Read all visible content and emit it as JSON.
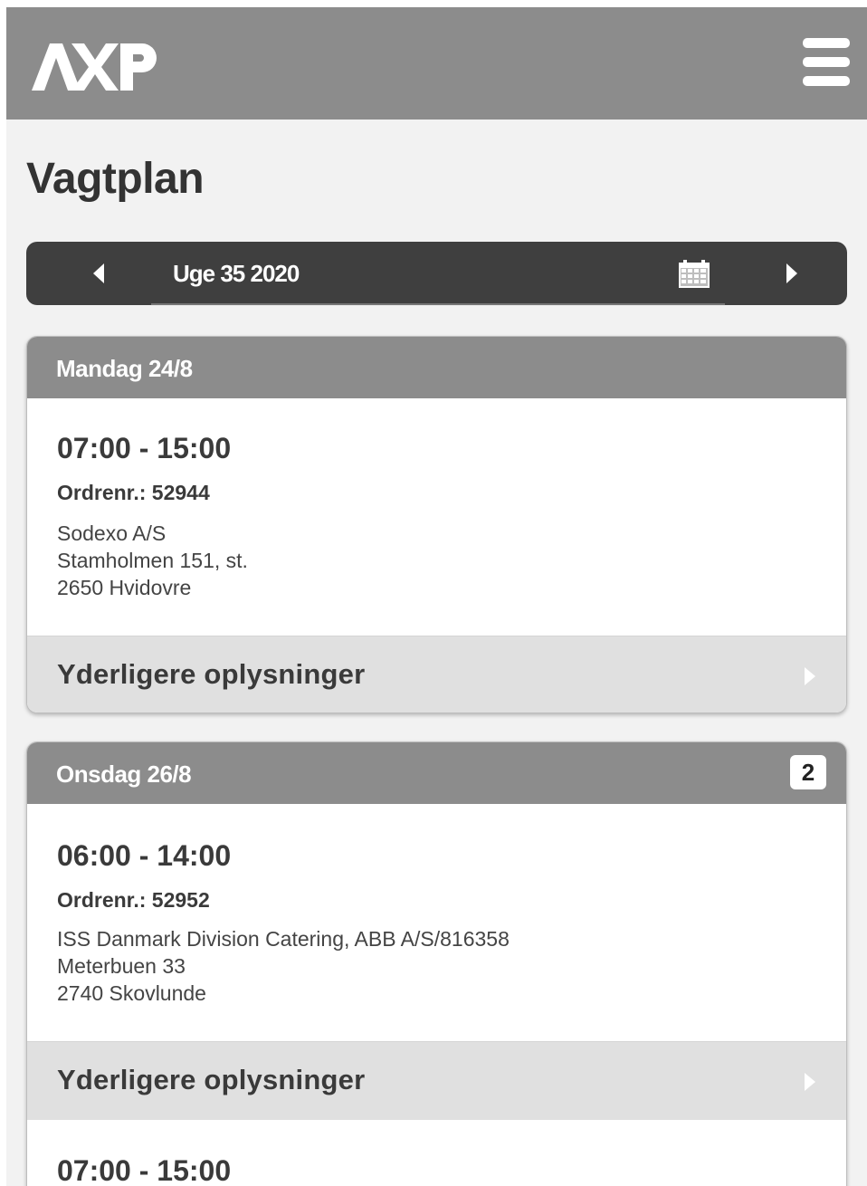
{
  "header": {
    "logo_text": "AXP",
    "menu_icon": "hamburger-menu-icon"
  },
  "page": {
    "title": "Vagtplan"
  },
  "week_nav": {
    "label": "Uge 35 2020",
    "prev_icon": "triangle-left-icon",
    "next_icon": "triangle-right-icon",
    "calendar_icon": "calendar-icon"
  },
  "days": [
    {
      "day_label": "Mandag 24/8",
      "badge": "",
      "shifts": [
        {
          "time": "07:00 - 15:00",
          "order": "Ordrenr.: 52944",
          "address": [
            "Sodexo A/S",
            "Stamholmen 151, st.",
            "2650 Hvidovre"
          ],
          "more_info": "Yderligere oplysninger"
        }
      ]
    },
    {
      "day_label": "Onsdag 26/8",
      "badge": "2",
      "shifts": [
        {
          "time": "06:00 - 14:00",
          "order": "Ordrenr.: 52952",
          "address": [
            "ISS Danmark Division Catering, ABB A/S/816358",
            "Meterbuen 33",
            "2740 Skovlunde"
          ],
          "more_info": "Yderligere oplysninger"
        },
        {
          "time": "07:00 - 15:00"
        }
      ]
    }
  ],
  "colors": {
    "topbar": "#8c8c8c",
    "weeknav": "#3f3f3f",
    "card_header": "#8c8c8c",
    "more_info_bg": "#e0e0e0",
    "background": "#f2f2f2"
  }
}
